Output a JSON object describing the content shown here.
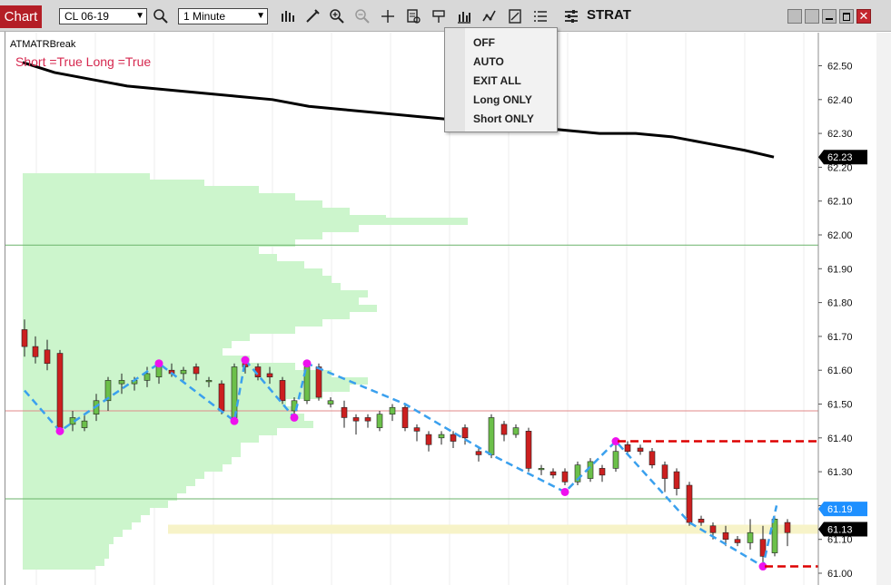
{
  "toolbar": {
    "tab_label": "Chart",
    "instrument": "CL 06-19",
    "interval": "1 Minute",
    "strategy_label": "STRAT",
    "icons": [
      "search-icon",
      "bar-type-icon",
      "draw-icon",
      "zoom-in-icon",
      "zoom-out-icon",
      "crosshair-icon",
      "data-box-icon",
      "chart-trader-icon",
      "indicators-icon",
      "strategies-icon",
      "templates-icon",
      "properties-icon",
      "strat-settings-icon"
    ]
  },
  "chart": {
    "indicator_name": "ATMATRBreak",
    "status_text": "Short =True Long =True",
    "price_ticks": [
      "62.50",
      "62.40",
      "62.30",
      "62.20",
      "62.10",
      "62.00",
      "61.90",
      "61.80",
      "61.70",
      "61.60",
      "61.50",
      "61.40",
      "61.30",
      "61.20",
      "61.10",
      "61.00"
    ],
    "price_badges": [
      {
        "label": "62.23",
        "price": 62.23,
        "bg": "#000000"
      },
      {
        "label": "61.19",
        "price": 61.19,
        "bg": "#1e90ff"
      },
      {
        "label": "61.13",
        "price": 61.13,
        "bg": "#000000"
      }
    ],
    "colors": {
      "up": "#6cc04a",
      "down": "#cc1f1f",
      "zigzag": "#3aa0ee",
      "pivot": "#ee11ee",
      "profile": "#ccf5cc",
      "ma": "#000000",
      "stop": "#dd0000",
      "hline_green": "#6ab36a",
      "hline_red": "#e08a8a",
      "value_band": "#f7f3c8"
    }
  },
  "strat_menu": {
    "items": [
      "OFF",
      "AUTO",
      "EXIT ALL",
      "Long ONLY",
      "Short ONLY"
    ]
  }
}
